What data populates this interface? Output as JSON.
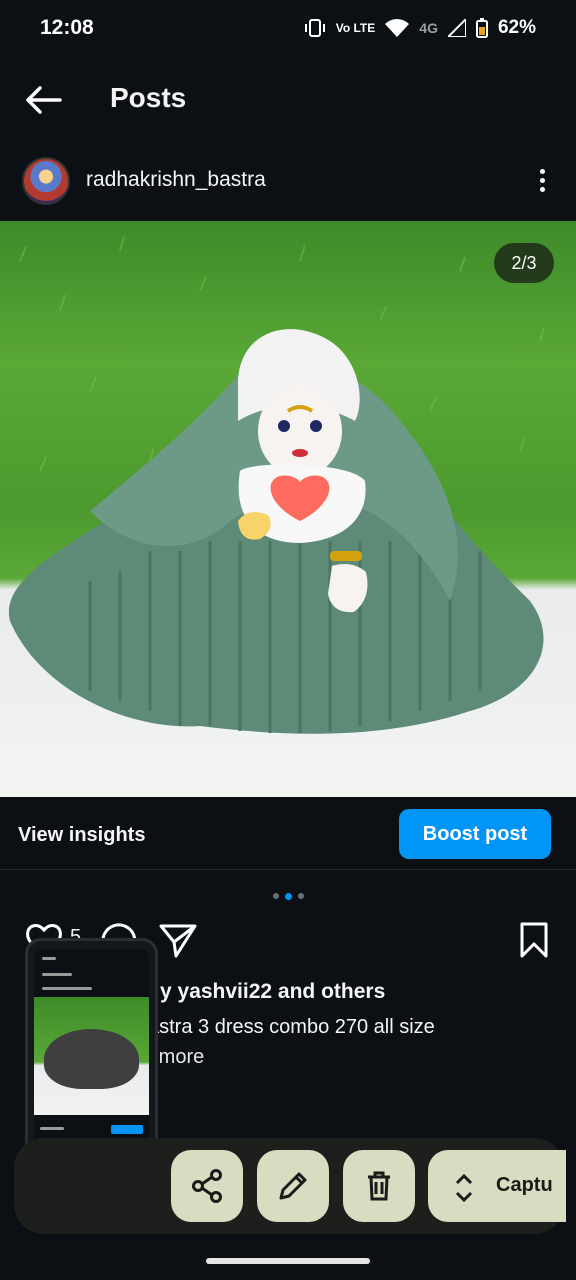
{
  "status_bar": {
    "time": "12:08",
    "volte": "Vo LTE",
    "network": "4G",
    "battery": "62%"
  },
  "header": {
    "title": "Posts"
  },
  "post": {
    "username": "radhakrishn_bastra",
    "image_counter": "2/3",
    "insights_label": "View insights",
    "boost_label": "Boost post",
    "likes_count": "5",
    "liked_by_text": "y yashvii22 and others",
    "caption_text": "astra 3 dress combo 270 all size",
    "caption_more": ".. more"
  },
  "toolbar": {
    "capture_label": "Captu"
  },
  "colors": {
    "accent": "#0095f6",
    "background": "#0c1014",
    "toolbar_button": "#d8dcc0"
  }
}
